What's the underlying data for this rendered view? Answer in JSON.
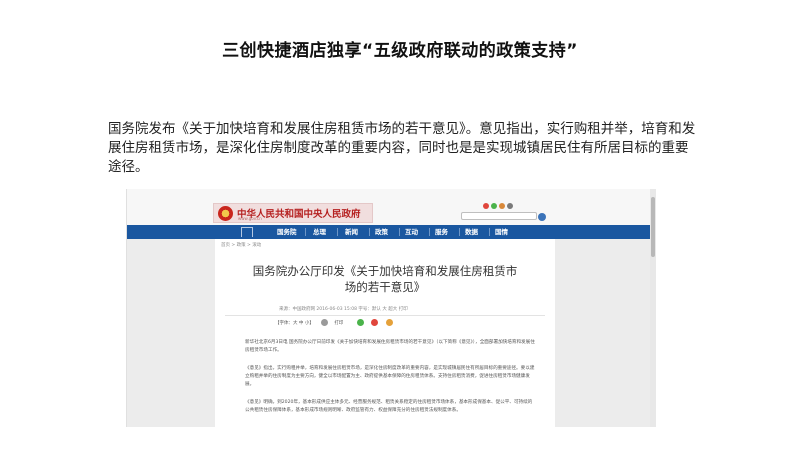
{
  "slide": {
    "title": "三创快捷酒店独享“五级政府联动的政策支持”",
    "body": "国务院发布《关于加快培育和发展住房租赁市场的若干意见》。意见指出，实行购租并举，培育和发展住房租赁市场，是深化住房制度改革的重要内容，同时也是是实现城镇居民住有所居目标的重要途径。"
  },
  "screenshot": {
    "site_logo": "中华人民共和国中央人民政府",
    "site_logo_sub": "www.gov.cn",
    "nav": [
      "国务院",
      "总理",
      "新闻",
      "政策",
      "互动",
      "服务",
      "数据",
      "国情"
    ],
    "breadcrumb": "首页 > 政策 > 滚动",
    "article_title_line1": "国务院办公厅印发《关于加快培育和发展住房租赁市",
    "article_title_line2": "场的若干意见》",
    "article_meta": "来源：中国政府网    2016-06-03 15:08    字号：默认 大 超大    打印",
    "toolbar_font": "【字体：大 中 小】",
    "toolbar_print": "打印",
    "para1": "新华社北京6月3日电 国务院办公厅日前印发《关于加快培育和发展住房租赁市场的若干意见》（以下简称《意见》），全面部署加快培育和发展住房租赁市场工作。",
    "para2": "《意见》指出，实行购租并举，培育和发展住房租赁市场，是深化住房制度改革的重要内容，是实现城镇居民住有所居目标的重要途径。要以建立购租并举的住房制度为主要方向，健全以市场配置为主、政府提供基本保障的住房租赁体系。支持住房租赁消费，促进住房租赁市场健康发展。",
    "para3": "《意见》明确，到2020年，基本形成供应主体多元、经营服务规范、租赁关系稳定的住房租赁市场体系，基本形成保基本、促公平、可持续的公共租赁住房保障体系，基本形成市场规则明晰、政府监管有力、权益保障充分的住房租赁法规制度体系。"
  },
  "colors": {
    "nav_blue": "#1a57a0",
    "logo_red": "#b51f1f"
  }
}
